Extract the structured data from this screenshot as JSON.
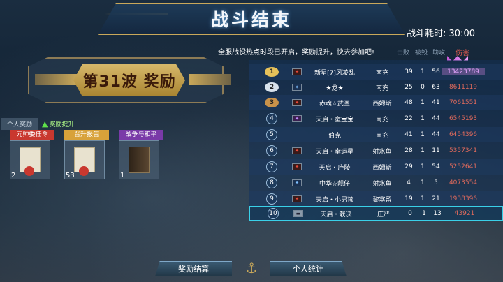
{
  "header": {
    "title": "战斗结束",
    "time_label": "战斗耗时:",
    "time_value": "30:00"
  },
  "notice": "全服战役热点时段已开启，奖励提升，快去参加吧!",
  "columns": {
    "destroy": "击败",
    "sunk": "被毁",
    "assist": "助攻",
    "damage": "伤害"
  },
  "wave": {
    "label": "第31波 奖励"
  },
  "reward_tabs": {
    "personal": "个人奖励",
    "upgrade": "奖励提升"
  },
  "rewards": [
    {
      "name": "元帅委任令",
      "count": "2",
      "icon": "commission-document-icon",
      "color": "#c9382f"
    },
    {
      "name": "晋升报告",
      "count": "53",
      "icon": "promotion-report-icon",
      "color": "#d8a23a"
    },
    {
      "name": "战争与和平",
      "count": "1",
      "icon": "war-and-peace-book-icon",
      "color": "#7a3aa8"
    }
  ],
  "scoreboard": [
    {
      "rank": "1",
      "name": "新星[7]风凌乱",
      "ship": "南充",
      "c1": "39",
      "c2": "1",
      "c3": "56",
      "damage": "13423789"
    },
    {
      "rank": "2",
      "name": "★龙★",
      "ship": "南充",
      "c1": "25",
      "c2": "0",
      "c3": "63",
      "damage": "8611119"
    },
    {
      "rank": "3",
      "name": "赤魂☆武圣",
      "ship": "西姆斯",
      "c1": "48",
      "c2": "1",
      "c3": "41",
      "damage": "7061551"
    },
    {
      "rank": "4",
      "name": "天启・童宝宝",
      "ship": "南充",
      "c1": "22",
      "c2": "1",
      "c3": "44",
      "damage": "6545193"
    },
    {
      "rank": "5",
      "name": "伯克",
      "ship": "南充",
      "c1": "41",
      "c2": "1",
      "c3": "44",
      "damage": "6454396"
    },
    {
      "rank": "6",
      "name": "天启・幸运星",
      "ship": "射水鱼",
      "c1": "28",
      "c2": "1",
      "c3": "11",
      "damage": "5357341"
    },
    {
      "rank": "7",
      "name": "天启・庐陵",
      "ship": "西姆斯",
      "c1": "29",
      "c2": "1",
      "c3": "54",
      "damage": "5252641"
    },
    {
      "rank": "8",
      "name": "中华☆靓仔",
      "ship": "射水鱼",
      "c1": "4",
      "c2": "1",
      "c3": "5",
      "damage": "4073554"
    },
    {
      "rank": "9",
      "name": "天启・小男孩",
      "ship": "黎塞留",
      "c1": "19",
      "c2": "1",
      "c3": "21",
      "damage": "1938396"
    },
    {
      "rank": "10",
      "name": "天启・栽决",
      "ship": "庄严",
      "c1": "0",
      "c2": "1",
      "c3": "13",
      "damage": "43921"
    }
  ],
  "bottom": {
    "settle": "奖励结算",
    "personal_stats": "个人统计"
  }
}
